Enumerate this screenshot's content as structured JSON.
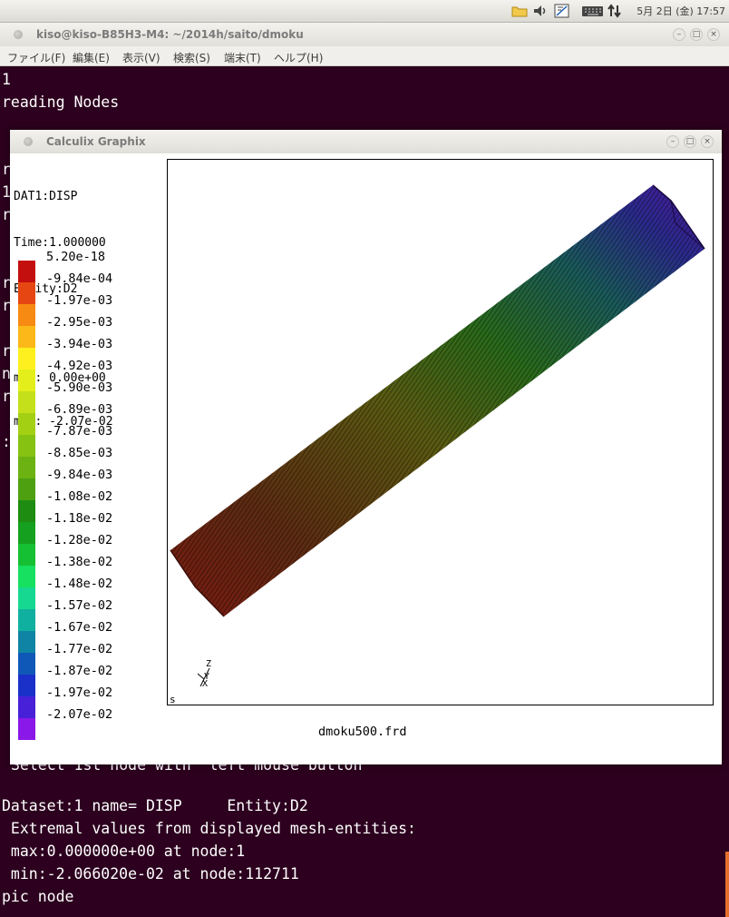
{
  "top_panel": {
    "clock": "5月 2日 (金) 17:57",
    "icons": [
      "folder-icon",
      "volume-icon",
      "network-icon",
      "keyboard-icon",
      "transfer-arrows-icon"
    ]
  },
  "terminal": {
    "title": "kiso@kiso-B85H3-M4: ~/2014h/saito/dmoku",
    "menu": [
      "ファイル(F)",
      "編集(E)",
      "表示(V)",
      "検索(S)",
      "端末(T)",
      "ヘルプ(H)"
    ],
    "lines_top": [
      "1",
      "reading Nodes"
    ],
    "partial_chars": [
      "r",
      "1",
      "r",
      "r",
      "r",
      "r",
      "n",
      "r",
      ":"
    ],
    "partial_line": "Select 1st node with  left mouse button",
    "lines_bottom": [
      "Dataset:1 name= DISP     Entity:D2",
      " Extremal values from displayed mesh-entities:",
      " max:0.000000e+00 at node:1",
      " min:-2.066020e-02 at node:112711",
      "pic node"
    ]
  },
  "cgx": {
    "title": "Calculix Graphix",
    "info_lines": [
      "DAT1:DISP",
      "Time:1.000000",
      "Entity:D2",
      "",
      "max: 0.00e+00",
      "min: -2.07e-02"
    ],
    "legend": {
      "labels": [
        "5.20e-18",
        "-9.84e-04",
        "-1.97e-03",
        "-2.95e-03",
        "-3.94e-03",
        "-4.92e-03",
        "-5.90e-03",
        "-6.89e-03",
        "-7.87e-03",
        "-8.85e-03",
        "-9.84e-03",
        "-1.08e-02",
        "-1.18e-02",
        "-1.28e-02",
        "-1.38e-02",
        "-1.48e-02",
        "-1.57e-02",
        "-1.67e-02",
        "-1.77e-02",
        "-1.87e-02",
        "-1.97e-02",
        "-2.07e-02"
      ],
      "colors": [
        "#c40f0f",
        "#e64712",
        "#f78a12",
        "#fbb818",
        "#fef01e",
        "#e4ee1a",
        "#c4e01a",
        "#a4d014",
        "#86c212",
        "#6cb212",
        "#4ea010",
        "#1e8c10",
        "#16a020",
        "#16c033",
        "#17e060",
        "#16d890",
        "#10b0a0",
        "#1084a4",
        "#1058b8",
        "#1a30c8",
        "#4820d8",
        "#8a18e8"
      ]
    },
    "filename": "dmoku500.frd",
    "corner_label": "s",
    "axes": {
      "z": "Z",
      "y": "Y",
      "x": "X"
    }
  }
}
